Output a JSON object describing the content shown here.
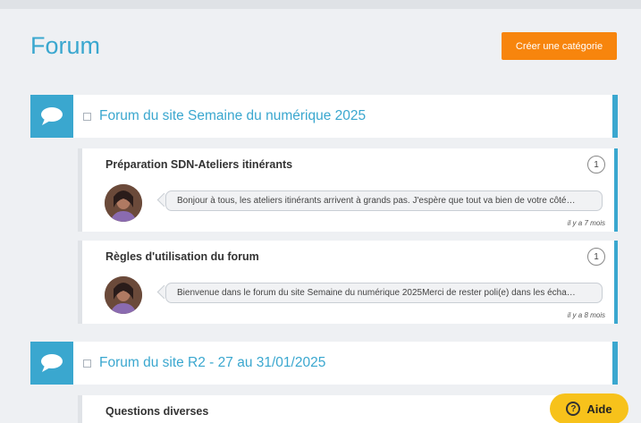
{
  "header": {
    "title": "Forum",
    "create_button_label": "Créer une catégorie"
  },
  "categories": [
    {
      "title": "Forum du site Semaine du numérique 2025",
      "topics": [
        {
          "title": "Préparation SDN-Ateliers itinérants",
          "count": "1",
          "excerpt": "Bonjour à tous, les ateliers itinérants arrivent à grands pas. J'espère que tout va bien de votre côté…",
          "time": "il y a 7 mois"
        },
        {
          "title": "Règles d'utilisation du forum",
          "count": "1",
          "excerpt": "Bienvenue dans le forum du site Semaine du numérique 2025Merci de rester poli(e) dans les écha…",
          "time": "il y a 8 mois"
        }
      ]
    },
    {
      "title": "Forum du site R2 - 27 au 31/01/2025",
      "topics": [
        {
          "title": "Questions diverses"
        }
      ]
    }
  ],
  "help": {
    "label": "Aide",
    "icon_glyph": "?"
  },
  "icons": {
    "category": "speech-bubble-icon",
    "help": "question-circle-icon"
  },
  "colors": {
    "accent": "#3aa7cf",
    "create_button": "#f7850d",
    "help_button": "#f7c21b"
  }
}
